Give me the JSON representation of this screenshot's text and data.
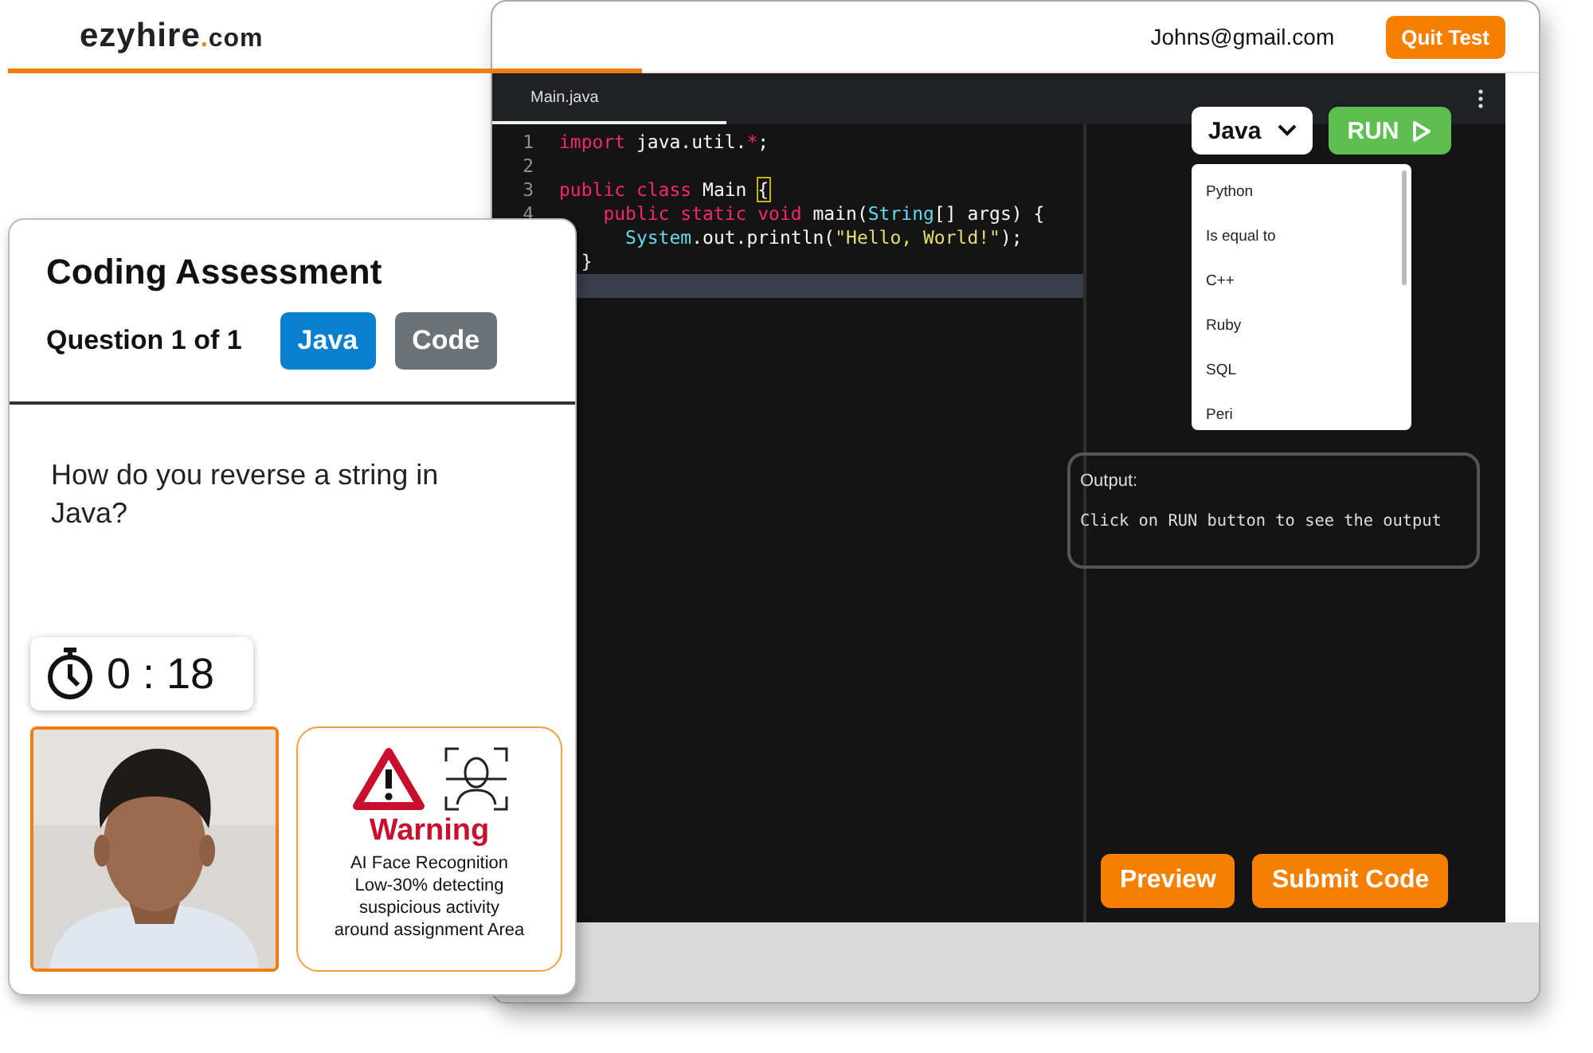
{
  "logo": {
    "name": "ezyhire",
    "suffix": ".com"
  },
  "editor_window": {
    "user_email": "Johns@gmail.com",
    "quit_button": "Quit Test",
    "file_tabs": [
      {
        "label": "Main.java",
        "selected": true
      }
    ],
    "code_lines": [
      {
        "number": "1",
        "active": false,
        "tokens": [
          {
            "kind": "keyword",
            "text": "import"
          },
          {
            "kind": "plain",
            "text": " java.util."
          },
          {
            "kind": "keyword",
            "text": "*"
          },
          {
            "kind": "plain",
            "text": ";"
          }
        ]
      },
      {
        "number": "2",
        "active": false
      },
      {
        "number": "3",
        "active": false,
        "tokens": [
          {
            "kind": "keyword",
            "text": "public class"
          },
          {
            "kind": "plain",
            "text": " Main "
          },
          {
            "kind": "matched-brace",
            "text": "{"
          }
        ]
      },
      {
        "number": "4",
        "active": false,
        "tokens": [
          {
            "kind": "keyword",
            "text": "    public static void"
          },
          {
            "kind": "plain",
            "text": " main("
          },
          {
            "kind": "type",
            "text": "String"
          },
          {
            "kind": "plain",
            "text": "[] args) {"
          }
        ]
      },
      {
        "active": false,
        "tokens": [
          {
            "kind": "type",
            "text": "      System"
          },
          {
            "kind": "plain",
            "text": ".out.println("
          },
          {
            "kind": "string",
            "text": "\"Hello, World!\""
          },
          {
            "kind": "plain",
            "text": ");"
          }
        ]
      },
      {
        "active": false,
        "tokens": [
          {
            "kind": "plain",
            "text": "  }"
          }
        ]
      },
      {
        "active": true
      }
    ],
    "language_select": {
      "value": "Java"
    },
    "run_button": "RUN",
    "language_options": [
      "Python",
      "Is equal to",
      "C++",
      "Ruby",
      "SQL",
      "Peri"
    ],
    "output": {
      "label": "Output:",
      "message": "Click on RUN button to see the output"
    },
    "buttons": [
      "Preview",
      "Submit Code"
    ]
  },
  "assessment_card": {
    "title": "Coding Assessment",
    "question_counter": "Question 1 of 1",
    "tags": [
      {
        "label": "Java",
        "color": "#0a7fd0"
      },
      {
        "label": "Code",
        "color": "#6b7378"
      }
    ],
    "question": "How do you reverse a string in Java?",
    "timer": "0 : 18",
    "warning": {
      "title": "Warning",
      "message": "AI Face Recognition\nLow-30% detecting\nsuspicious activity\naround assignment Area"
    }
  }
}
